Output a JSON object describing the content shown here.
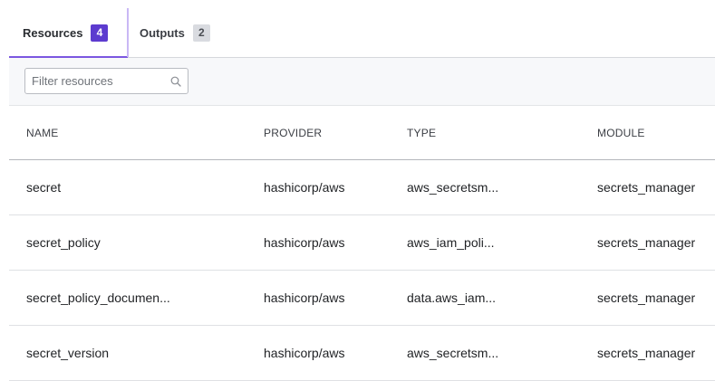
{
  "tabs": [
    {
      "label": "Resources",
      "count": "4"
    },
    {
      "label": "Outputs",
      "count": "2"
    }
  ],
  "filter": {
    "placeholder": "Filter resources",
    "value": ""
  },
  "table": {
    "columns": [
      "NAME",
      "PROVIDER",
      "TYPE",
      "MODULE"
    ],
    "rows": [
      {
        "name": "secret",
        "provider": "hashicorp/aws",
        "type": "aws_secretsm...",
        "module": "secrets_manager"
      },
      {
        "name": "secret_policy",
        "provider": "hashicorp/aws",
        "type": "aws_iam_poli...",
        "module": "secrets_manager"
      },
      {
        "name": "secret_policy_documen...",
        "provider": "hashicorp/aws",
        "type": "data.aws_iam...",
        "module": "secrets_manager"
      },
      {
        "name": "secret_version",
        "provider": "hashicorp/aws",
        "type": "aws_secretsm...",
        "module": "secrets_manager"
      }
    ]
  },
  "colors": {
    "accent": "#7b57e0",
    "badge_active": "#5c3bcf"
  }
}
